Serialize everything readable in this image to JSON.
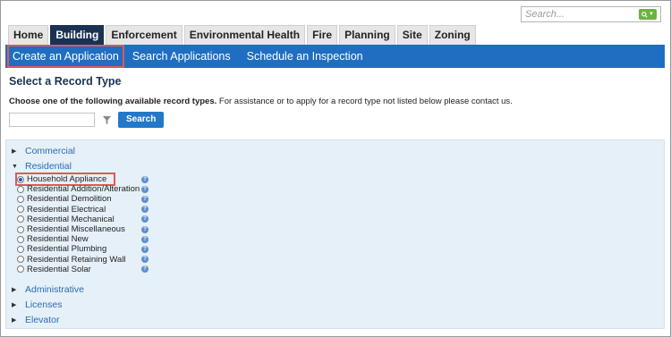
{
  "global_search": {
    "placeholder": "Search..."
  },
  "tabs": [
    {
      "label": "Home",
      "active": false
    },
    {
      "label": "Building",
      "active": true
    },
    {
      "label": "Enforcement",
      "active": false
    },
    {
      "label": "Environmental Health",
      "active": false
    },
    {
      "label": "Fire",
      "active": false
    },
    {
      "label": "Planning",
      "active": false
    },
    {
      "label": "Site",
      "active": false
    },
    {
      "label": "Zoning",
      "active": false
    }
  ],
  "menu": {
    "create": "Create an Application",
    "search": "Search Applications",
    "schedule": "Schedule an Inspection"
  },
  "page": {
    "title": "Select a Record Type",
    "instructions_bold": "Choose one of the following available record types.",
    "instructions_rest": " For assistance or to apply for a record type not listed below please contact us.",
    "search_button": "Search"
  },
  "categories": {
    "commercial": "Commercial",
    "residential": "Residential",
    "administrative": "Administrative",
    "licenses": "Licenses",
    "elevator": "Elevator"
  },
  "residential_types": [
    {
      "label": "Household Appliance",
      "checked": true
    },
    {
      "label": "Residential Addition/Alteration",
      "checked": false
    },
    {
      "label": "Residential Demolition",
      "checked": false
    },
    {
      "label": "Residential Electrical",
      "checked": false
    },
    {
      "label": "Residential Mechanical",
      "checked": false
    },
    {
      "label": "Residential Miscellaneous",
      "checked": false
    },
    {
      "label": "Residential New",
      "checked": false
    },
    {
      "label": "Residential Plumbing",
      "checked": false
    },
    {
      "label": "Residential Retaining Wall",
      "checked": false
    },
    {
      "label": "Residential Solar",
      "checked": false
    }
  ],
  "colors": {
    "menu_bar": "#1f6ec1",
    "active_tab": "#1a3252",
    "highlight_box": "#e05858",
    "search_go": "#6cb33f",
    "panel_bg": "#e6f0f8"
  }
}
